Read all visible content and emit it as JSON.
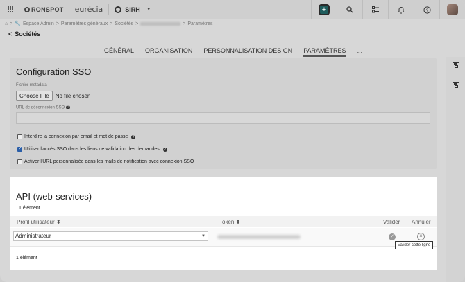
{
  "topbar": {
    "brand": "RONSPOT",
    "brand_secondary": "eurécia",
    "app_name": "SIRH"
  },
  "breadcrumb": {
    "home": "⌂",
    "items": [
      "Espace Admin",
      "Paramètres généraux",
      "Sociétés",
      "Paramètres"
    ]
  },
  "page": {
    "title": "Sociétés"
  },
  "tabs": [
    {
      "label": "GÉNÉRAL"
    },
    {
      "label": "ORGANISATION"
    },
    {
      "label": "PERSONNALISATION DESIGN"
    },
    {
      "label": "PARAMÈTRES"
    },
    {
      "label": "..."
    }
  ],
  "sso": {
    "title": "Configuration SSO",
    "metadata_label": "Fichier metadata",
    "choose_file": "Choose File",
    "no_file": "No file chosen",
    "logout_url_label": "URL de déconnexion SSO",
    "options": [
      {
        "label": "Interdire la connexion par email et mot de passe",
        "checked": false
      },
      {
        "label": "Utiliser l'accès SSO dans les liens de validation des demandes",
        "checked": true
      },
      {
        "label": "Activer l'URL personnalisée dans les mails de notification avec connexion SSO",
        "checked": false
      }
    ]
  },
  "api": {
    "title": "API (web-services)",
    "count_top": "1 élément",
    "columns": {
      "profile": "Profil utilisateur",
      "token": "Token",
      "validate": "Valider",
      "cancel": "Annuler"
    },
    "row": {
      "profile": "Administrateur"
    },
    "tooltip": "Valider cette ligne",
    "count_bottom": "1 élément"
  },
  "colors": {
    "accent": "#1e5c5c",
    "checkbox_on": "#2a5ea8"
  }
}
